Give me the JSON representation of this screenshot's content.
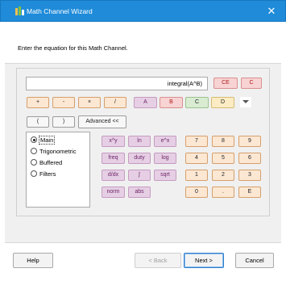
{
  "window": {
    "title": "Math Channel Wizard",
    "close_glyph": "✕",
    "icon": "wizard-icon"
  },
  "header": {
    "prompt": "Enter the equation for this Math Channel."
  },
  "equation": {
    "value": "integral(A^B)"
  },
  "buttons": {
    "ce": "CE",
    "c": "C",
    "plus": "+",
    "minus": "-",
    "times": "×",
    "divide": "/",
    "ch_a": "A",
    "ch_b": "B",
    "ch_c": "C",
    "ch_d": "D",
    "open_paren": "(",
    "close_paren": ")",
    "advanced": "Advanced <<"
  },
  "function_categories": [
    {
      "label": "Main",
      "checked": true
    },
    {
      "label": "Trigonometric",
      "checked": false
    },
    {
      "label": "Buffered",
      "checked": false
    },
    {
      "label": "Filters",
      "checked": false
    }
  ],
  "functions": [
    "x^y",
    "ln",
    "e^x",
    "freq",
    "duty",
    "log",
    "d/dx",
    "∫",
    "sqrt",
    "norm",
    "abs"
  ],
  "keypad": [
    "7",
    "8",
    "9",
    "4",
    "5",
    "6",
    "1",
    "2",
    "3",
    "0",
    ".",
    "E"
  ],
  "footer": {
    "help": "Help",
    "back": "< Back",
    "next": "Next >",
    "cancel": "Cancel"
  },
  "colors": {
    "titlebar": "#1f8bd9",
    "operator": "#fce7d3",
    "clear": "#f8d3d3",
    "function": "#e6cfe4",
    "channel_a": "#e6cfe4",
    "channel_b": "#f8d3d3",
    "channel_c": "#d9ecd2",
    "channel_d": "#fbecc4"
  }
}
